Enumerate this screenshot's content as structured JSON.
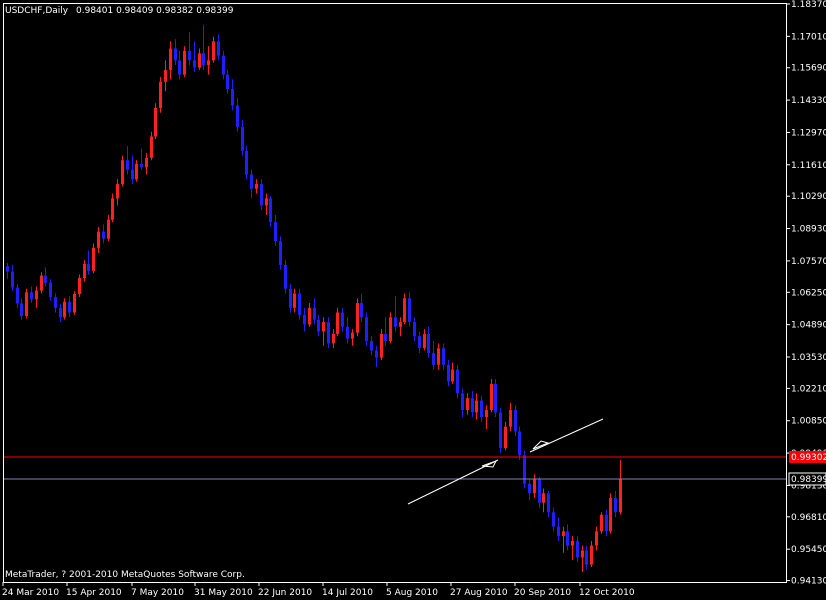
{
  "header": {
    "symbol": "USDCHF,Daily",
    "ohlc": "0.98401 0.98409 0.98382 0.98399"
  },
  "copyright": "MetaTrader, ? 2001-2010 MetaQuotes Software Corp.",
  "colors": {
    "background": "#000000",
    "frame": "#ffffff",
    "bull_candle": "#ff2020",
    "bear_candle": "#2020ff",
    "resistance_line": "#ff0000",
    "bid_line": "#8080c0",
    "trendline": "#ffffff"
  },
  "chart_data": {
    "type": "candlestick",
    "symbol": "USDCHF",
    "timeframe": "Daily",
    "y_ticks": [
      "1.18370",
      "1.17010",
      "1.15690",
      "1.14330",
      "1.12970",
      "1.11610",
      "1.10290",
      "1.08930",
      "1.07570",
      "1.06250",
      "1.04890",
      "1.03530",
      "1.02210",
      "1.00850",
      "0.99490",
      "0.98130",
      "0.96810",
      "0.95450",
      "0.94130"
    ],
    "ylim": [
      0.9407,
      1.1837
    ],
    "x_tick_labels": [
      "24 Mar 2010",
      "15 Apr 2010",
      "7 May 2010",
      "31 May 2010",
      "22 Jun 2010",
      "14 Jul 2010",
      "5 Aug 2010",
      "27 Aug 2010",
      "20 Sep 2010",
      "12 Oct 2010"
    ],
    "price_labels": {
      "resistance": "0.99302",
      "bid": "0.98399"
    },
    "levels": {
      "resistance": 0.993,
      "bid": 0.98399
    },
    "trendlines": [
      {
        "from": [
          "2010-09-01",
          0.976
        ],
        "to": [
          "2010-09-17",
          0.9932
        ]
      },
      {
        "from": [
          "2010-09-20",
          0.9945
        ],
        "to": [
          "2010-10-06",
          1.009
        ]
      }
    ],
    "candles": [
      [
        1.0735,
        1.0748,
        1.0682,
        1.0712
      ],
      [
        1.0712,
        1.074,
        1.063,
        1.0645
      ],
      [
        1.0645,
        1.066,
        1.056,
        1.0578
      ],
      [
        1.0578,
        1.06,
        1.051,
        1.0525
      ],
      [
        1.0525,
        1.064,
        1.0515,
        1.0625
      ],
      [
        1.0625,
        1.065,
        1.058,
        1.0595
      ],
      [
        1.0595,
        1.065,
        1.056,
        1.0632
      ],
      [
        1.0632,
        1.071,
        1.062,
        1.0695
      ],
      [
        1.0695,
        1.073,
        1.065,
        1.0665
      ],
      [
        1.0665,
        1.068,
        1.059,
        1.0605
      ],
      [
        1.0605,
        1.062,
        1.054,
        1.056
      ],
      [
        1.056,
        1.0575,
        1.05,
        1.052
      ],
      [
        1.052,
        1.06,
        1.051,
        1.0585
      ],
      [
        1.0585,
        1.061,
        1.052,
        1.054
      ],
      [
        1.054,
        1.063,
        1.053,
        1.0618
      ],
      [
        1.0618,
        1.07,
        1.0605,
        1.0685
      ],
      [
        1.0685,
        1.076,
        1.067,
        1.0745
      ],
      [
        1.0745,
        1.08,
        1.07,
        1.0715
      ],
      [
        1.0715,
        1.083,
        1.0705,
        1.0812
      ],
      [
        1.0812,
        1.09,
        1.079,
        1.088
      ],
      [
        1.088,
        1.091,
        1.083,
        1.085
      ],
      [
        1.085,
        1.095,
        1.084,
        1.093
      ],
      [
        1.093,
        1.104,
        1.092,
        1.102
      ],
      [
        1.102,
        1.11,
        1.099,
        1.108
      ],
      [
        1.108,
        1.12,
        1.107,
        1.118
      ],
      [
        1.118,
        1.124,
        1.112,
        1.114
      ],
      [
        1.114,
        1.12,
        1.108,
        1.11
      ],
      [
        1.11,
        1.118,
        1.109,
        1.1165
      ],
      [
        1.1165,
        1.123,
        1.114,
        1.115
      ],
      [
        1.115,
        1.121,
        1.112,
        1.119
      ],
      [
        1.119,
        1.13,
        1.118,
        1.128
      ],
      [
        1.128,
        1.142,
        1.127,
        1.14
      ],
      [
        1.14,
        1.153,
        1.138,
        1.151
      ],
      [
        1.151,
        1.16,
        1.147,
        1.156
      ],
      [
        1.156,
        1.168,
        1.152,
        1.165
      ],
      [
        1.165,
        1.169,
        1.158,
        1.16
      ],
      [
        1.16,
        1.164,
        1.152,
        1.154
      ],
      [
        1.154,
        1.166,
        1.153,
        1.164
      ],
      [
        1.164,
        1.172,
        1.158,
        1.16
      ],
      [
        1.16,
        1.168,
        1.155,
        1.157
      ],
      [
        1.157,
        1.165,
        1.156,
        1.163
      ],
      [
        1.163,
        1.175,
        1.156,
        1.158
      ],
      [
        1.158,
        1.166,
        1.154,
        1.16
      ],
      [
        1.16,
        1.17,
        1.159,
        1.168
      ],
      [
        1.168,
        1.171,
        1.16,
        1.162
      ],
      [
        1.162,
        1.164,
        1.152,
        1.154
      ],
      [
        1.154,
        1.156,
        1.146,
        1.148
      ],
      [
        1.148,
        1.152,
        1.139,
        1.141
      ],
      [
        1.141,
        1.144,
        1.13,
        1.132
      ],
      [
        1.132,
        1.135,
        1.12,
        1.122
      ],
      [
        1.122,
        1.124,
        1.11,
        1.112
      ],
      [
        1.112,
        1.114,
        1.102,
        1.106
      ],
      [
        1.106,
        1.11,
        1.104,
        1.108
      ],
      [
        1.108,
        1.11,
        1.097,
        1.099
      ],
      [
        1.099,
        1.104,
        1.095,
        1.102
      ],
      [
        1.102,
        1.103,
        1.09,
        1.092
      ],
      [
        1.092,
        1.095,
        1.082,
        1.084
      ],
      [
        1.084,
        1.086,
        1.072,
        1.074
      ],
      [
        1.074,
        1.076,
        1.062,
        1.064
      ],
      [
        1.064,
        1.066,
        1.054,
        1.056
      ],
      [
        1.056,
        1.064,
        1.054,
        1.062
      ],
      [
        1.062,
        1.064,
        1.051,
        1.053
      ],
      [
        1.053,
        1.056,
        1.046,
        1.049
      ],
      [
        1.049,
        1.058,
        1.048,
        1.056
      ],
      [
        1.056,
        1.06,
        1.049,
        1.051
      ],
      [
        1.051,
        1.053,
        1.044,
        1.046
      ],
      [
        1.046,
        1.052,
        1.04,
        1.05
      ],
      [
        1.05,
        1.052,
        1.039,
        1.041
      ],
      [
        1.041,
        1.047,
        1.039,
        1.045
      ],
      [
        1.045,
        1.056,
        1.044,
        1.054
      ],
      [
        1.054,
        1.056,
        1.046,
        1.048
      ],
      [
        1.048,
        1.052,
        1.041,
        1.043
      ],
      [
        1.043,
        1.047,
        1.04,
        1.0455
      ],
      [
        1.0455,
        1.06,
        1.044,
        1.058
      ],
      [
        1.058,
        1.062,
        1.05,
        1.052
      ],
      [
        1.052,
        1.054,
        1.04,
        1.042
      ],
      [
        1.042,
        1.044,
        1.036,
        1.038
      ],
      [
        1.038,
        1.04,
        1.031,
        1.035
      ],
      [
        1.035,
        1.047,
        1.034,
        1.045
      ],
      [
        1.045,
        1.052,
        1.04,
        1.042
      ],
      [
        1.042,
        1.054,
        1.041,
        1.052
      ],
      [
        1.052,
        1.061,
        1.046,
        1.048
      ],
      [
        1.048,
        1.052,
        1.044,
        1.05
      ],
      [
        1.05,
        1.062,
        1.049,
        1.06
      ],
      [
        1.06,
        1.0625,
        1.048,
        1.05
      ],
      [
        1.05,
        1.052,
        1.042,
        1.044
      ],
      [
        1.044,
        1.046,
        1.037,
        1.039
      ],
      [
        1.039,
        1.047,
        1.038,
        1.045
      ],
      [
        1.045,
        1.048,
        1.035,
        1.037
      ],
      [
        1.037,
        1.042,
        1.03,
        1.032
      ],
      [
        1.032,
        1.041,
        1.03,
        1.039
      ],
      [
        1.039,
        1.041,
        1.03,
        1.032
      ],
      [
        1.032,
        1.034,
        1.023,
        1.025
      ],
      [
        1.025,
        1.033,
        1.024,
        1.03
      ],
      [
        1.03,
        1.032,
        1.018,
        1.02
      ],
      [
        1.02,
        1.022,
        1.01,
        1.013
      ],
      [
        1.013,
        1.02,
        1.011,
        1.018
      ],
      [
        1.018,
        1.021,
        1.01,
        1.012
      ],
      [
        1.012,
        1.02,
        1.009,
        1.017
      ],
      [
        1.017,
        1.019,
        1.008,
        1.01
      ],
      [
        1.01,
        1.015,
        1.005,
        1.013
      ],
      [
        1.013,
        1.026,
        1.012,
        1.024
      ],
      [
        1.024,
        1.026,
        1.01,
        1.012
      ],
      [
        1.012,
        1.014,
        0.995,
        0.997
      ],
      [
        0.997,
        1.008,
        0.996,
        1.006
      ],
      [
        1.006,
        1.016,
        1.004,
        1.013
      ],
      [
        1.013,
        1.015,
        1.002,
        1.004
      ],
      [
        1.004,
        1.006,
        0.992,
        0.994
      ],
      [
        0.994,
        0.996,
        0.98,
        0.982
      ],
      [
        0.982,
        0.984,
        0.975,
        0.978
      ],
      [
        0.978,
        0.986,
        0.976,
        0.984
      ],
      [
        0.984,
        0.985,
        0.972,
        0.974
      ],
      [
        0.974,
        0.98,
        0.97,
        0.978
      ],
      [
        0.978,
        0.979,
        0.968,
        0.97
      ],
      [
        0.97,
        0.972,
        0.962,
        0.964
      ],
      [
        0.964,
        0.968,
        0.958,
        0.96
      ],
      [
        0.96,
        0.964,
        0.953,
        0.962
      ],
      [
        0.962,
        0.965,
        0.954,
        0.956
      ],
      [
        0.956,
        0.96,
        0.95,
        0.958
      ],
      [
        0.958,
        0.96,
        0.949,
        0.951
      ],
      [
        0.951,
        0.956,
        0.945,
        0.954
      ],
      [
        0.954,
        0.956,
        0.946,
        0.948
      ],
      [
        0.948,
        0.958,
        0.947,
        0.956
      ],
      [
        0.956,
        0.964,
        0.954,
        0.962
      ],
      [
        0.962,
        0.97,
        0.961,
        0.969
      ],
      [
        0.969,
        0.971,
        0.96,
        0.962
      ],
      [
        0.962,
        0.978,
        0.961,
        0.976
      ],
      [
        0.976,
        0.979,
        0.968,
        0.97
      ],
      [
        0.97,
        0.992,
        0.969,
        0.984
      ]
    ]
  }
}
